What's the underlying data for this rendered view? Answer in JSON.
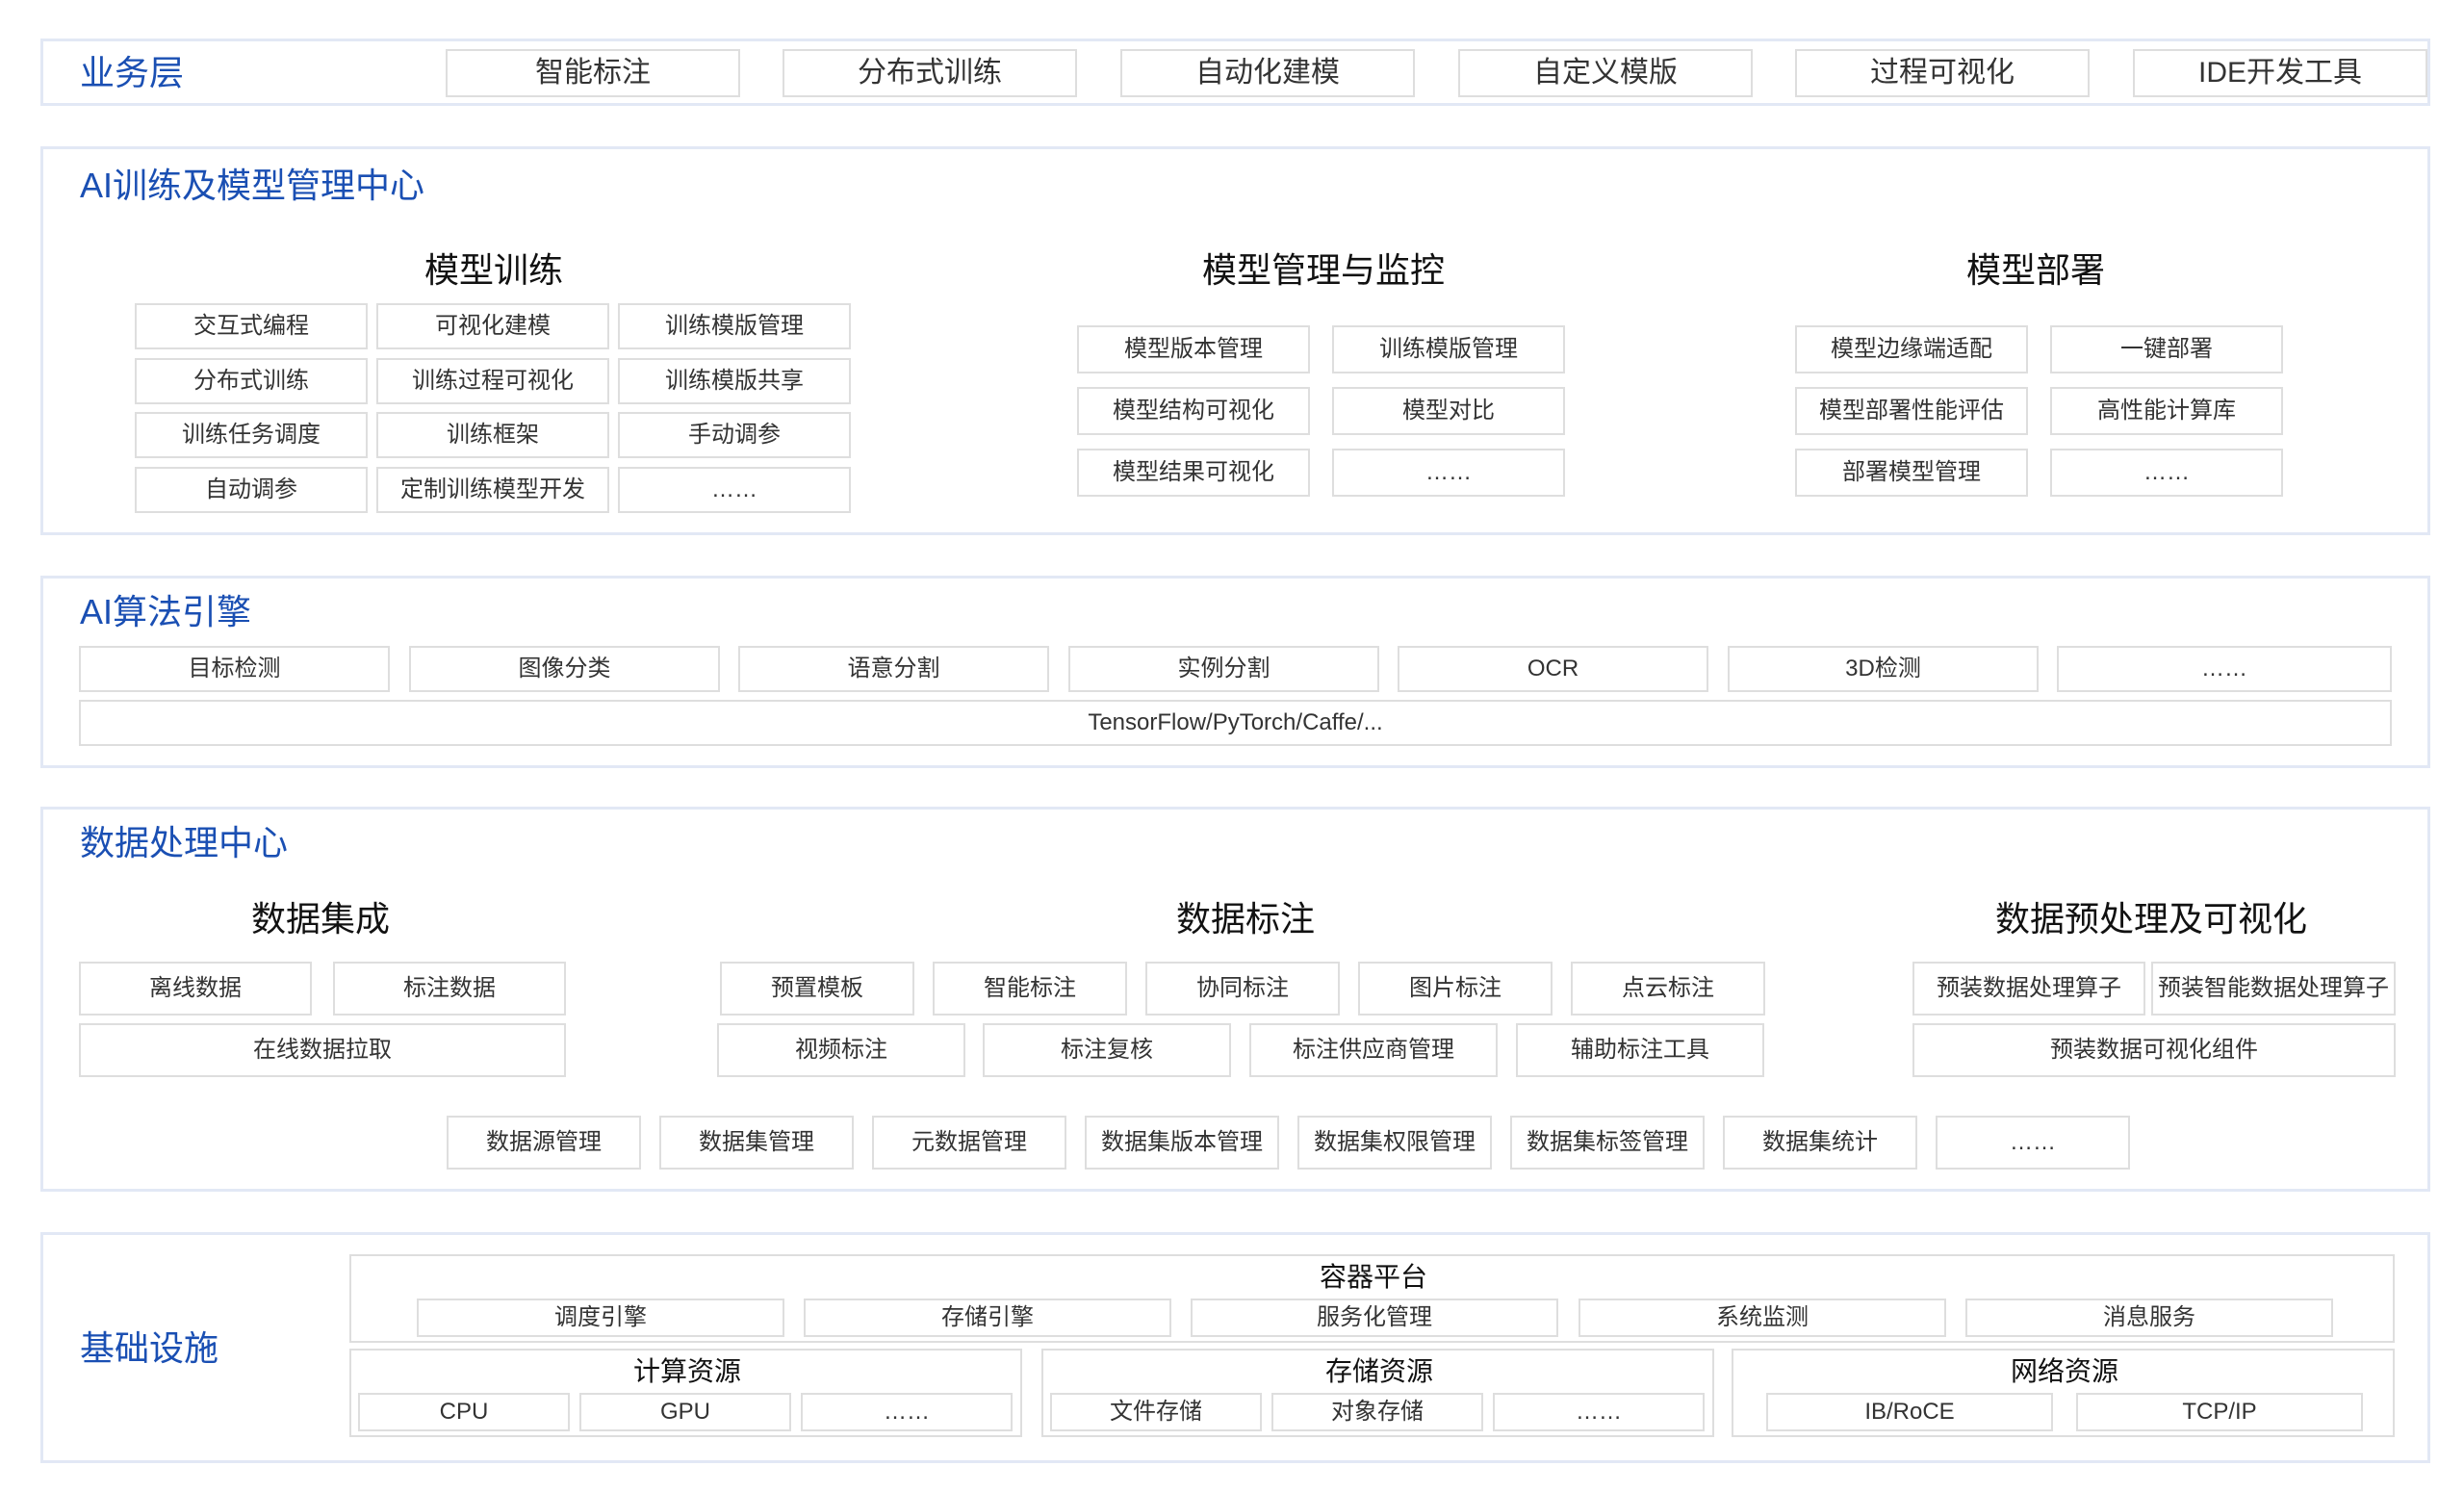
{
  "colors": {
    "title": "#1a4fb3",
    "border": "#dedede",
    "layer_border": "#e2e8f5",
    "text": "#333333"
  },
  "business": {
    "title": "业务层",
    "items": [
      "智能标注",
      "分布式训练",
      "自动化建模",
      "自定义模版",
      "过程可视化",
      "IDE开发工具"
    ]
  },
  "ai_center": {
    "title": "AI训练及模型管理中心",
    "training": {
      "title": "模型训练",
      "items": [
        "交互式编程",
        "可视化建模",
        "训练模版管理",
        "分布式训练",
        "训练过程可视化",
        "训练模版共享",
        "训练任务调度",
        "训练框架",
        "手动调参",
        "自动调参",
        "定制训练模型开发",
        "……"
      ]
    },
    "management": {
      "title": "模型管理与监控",
      "items": [
        "模型版本管理",
        "训练模版管理",
        "模型结构可视化",
        "模型对比",
        "模型结果可视化",
        "……"
      ]
    },
    "deployment": {
      "title": "模型部署",
      "items": [
        "模型边缘端适配",
        "一键部署",
        "模型部署性能评估",
        "高性能计算库",
        "部署模型管理",
        "……"
      ]
    }
  },
  "algo": {
    "title": "AI算法引擎",
    "items": [
      "目标检测",
      "图像分类",
      "语意分割",
      "实例分割",
      "OCR",
      "3D检测",
      "……"
    ],
    "frameworks": "TensorFlow/PyTorch/Caffe/..."
  },
  "data_center": {
    "title": "数据处理中心",
    "integration": {
      "title": "数据集成",
      "items": [
        "离线数据",
        "标注数据",
        "在线数据拉取"
      ]
    },
    "annotation": {
      "title": "数据标注",
      "items": [
        "预置模板",
        "智能标注",
        "协同标注",
        "图片标注",
        "点云标注",
        "视频标注",
        "标注复核",
        "标注供应商管理",
        "辅助标注工具"
      ]
    },
    "preprocess": {
      "title": "数据预处理及可视化",
      "items": [
        "预装数据处理算子",
        "预装智能数据处理算子",
        "预装数据可视化组件"
      ]
    },
    "bottom": [
      "数据源管理",
      "数据集管理",
      "元数据管理",
      "数据集版本管理",
      "数据集权限管理",
      "数据集标签管理",
      "数据集统计",
      "……"
    ]
  },
  "infra": {
    "title": "基础设施",
    "container": {
      "title": "容器平台",
      "items": [
        "调度引擎",
        "存储引擎",
        "服务化管理",
        "系统监测",
        "消息服务"
      ]
    },
    "compute": {
      "title": "计算资源",
      "items": [
        "CPU",
        "GPU",
        "……"
      ]
    },
    "storage": {
      "title": "存储资源",
      "items": [
        "文件存储",
        "对象存储",
        "……"
      ]
    },
    "network": {
      "title": "网络资源",
      "items": [
        "IB/RoCE",
        "TCP/IP"
      ]
    }
  }
}
